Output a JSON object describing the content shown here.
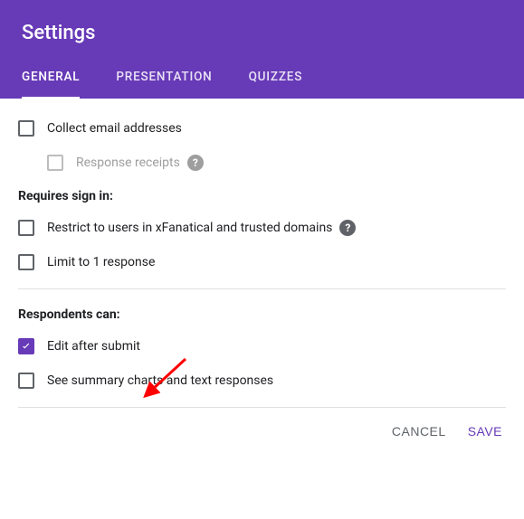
{
  "header": {
    "title": "Settings"
  },
  "tabs": {
    "general": "GENERAL",
    "presentation": "PRESENTATION",
    "quizzes": "QUIZZES"
  },
  "options": {
    "collect_email": "Collect email addresses",
    "response_receipts": "Response receipts",
    "requires_signin_title": "Requires sign in:",
    "restrict_domain": "Restrict to users in xFanatical and trusted domains",
    "limit_one": "Limit to 1 response",
    "respondents_can_title": "Respondents can:",
    "edit_after_submit": "Edit after submit",
    "see_summary": "See summary charts and text responses"
  },
  "footer": {
    "cancel": "CANCEL",
    "save": "SAVE"
  },
  "help_glyph": "?"
}
